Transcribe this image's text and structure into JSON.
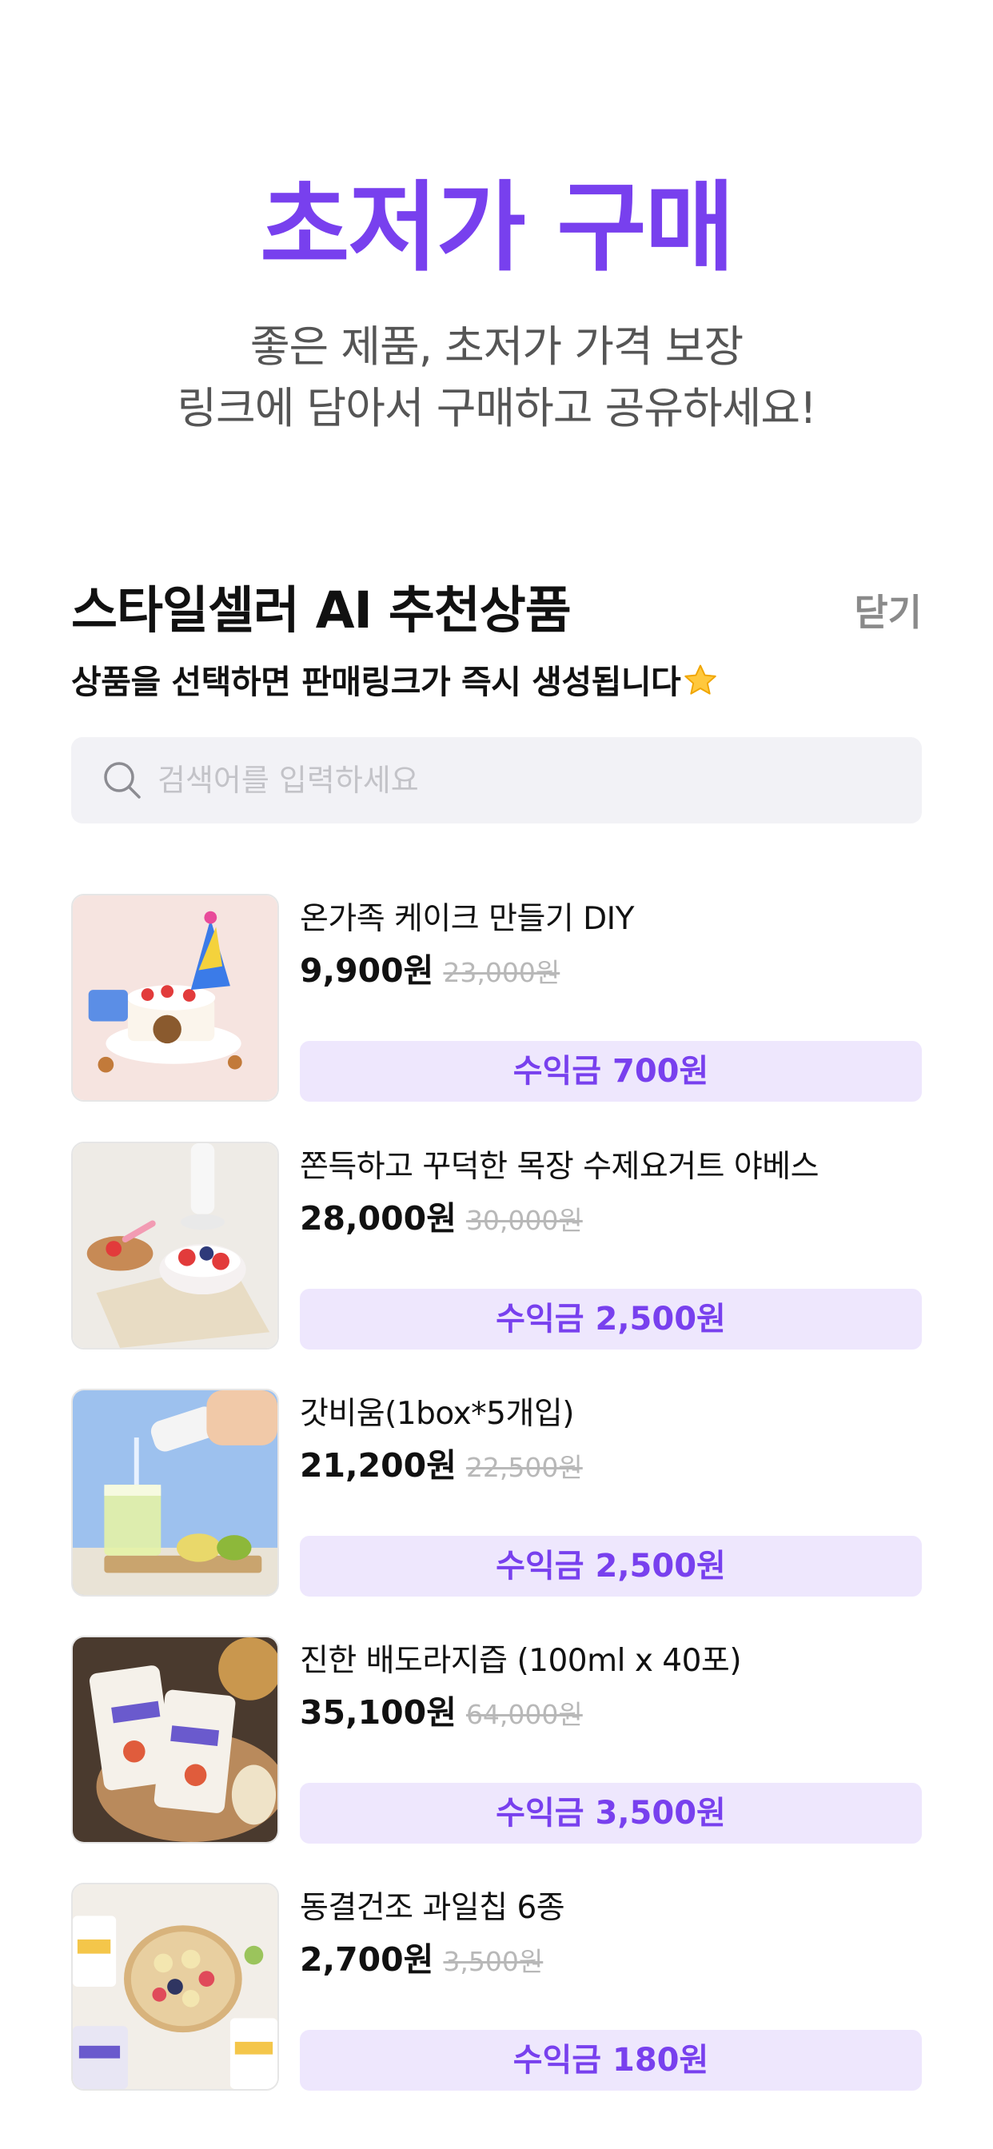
{
  "hero": {
    "title": "초저가 구매",
    "subtitle_line1": "좋은 제품, 초저가 가격 보장",
    "subtitle_line2": "링크에 담아서 구매하고 공유하세요!"
  },
  "section": {
    "title": "스타일셀러 AI 추천상품",
    "close_label": "닫기",
    "subtitle": "상품을 선택하면 판매링크가 즉시 생성됩니다",
    "subtitle_icon": "star-emoji-icon"
  },
  "search": {
    "placeholder": "검색어를 입력하세요",
    "value": "",
    "icon": "search-icon"
  },
  "colors": {
    "accent": "#7840EE",
    "profit_bg": "#EEE7FD",
    "search_bg": "#F2F2F6"
  },
  "products": [
    {
      "name": "온가족 케이크 만들기 DIY",
      "price": "9,900원",
      "original_price": "23,000원",
      "profit": "수익금 700원",
      "image": "cake-diy-photo"
    },
    {
      "name": "쫀득하고 꾸덕한 목장 수제요거트 야베스",
      "price": "28,000원",
      "original_price": "30,000원",
      "profit": "수익금 2,500원",
      "image": "yogurt-photo"
    },
    {
      "name": "갓비움(1box*5개입)",
      "price": "21,200원",
      "original_price": "22,500원",
      "profit": "수익금 2,500원",
      "image": "drink-pour-photo"
    },
    {
      "name": "진한 배도라지즙 (100ml x 40포)",
      "price": "35,100원",
      "original_price": "64,000원",
      "profit": "수익금 3,500원",
      "image": "pear-juice-pouch-photo"
    },
    {
      "name": "동결건조 과일칩 6종",
      "price": "2,700원",
      "original_price": "3,500원",
      "profit": "수익금 180원",
      "image": "fruit-chips-photo"
    }
  ]
}
